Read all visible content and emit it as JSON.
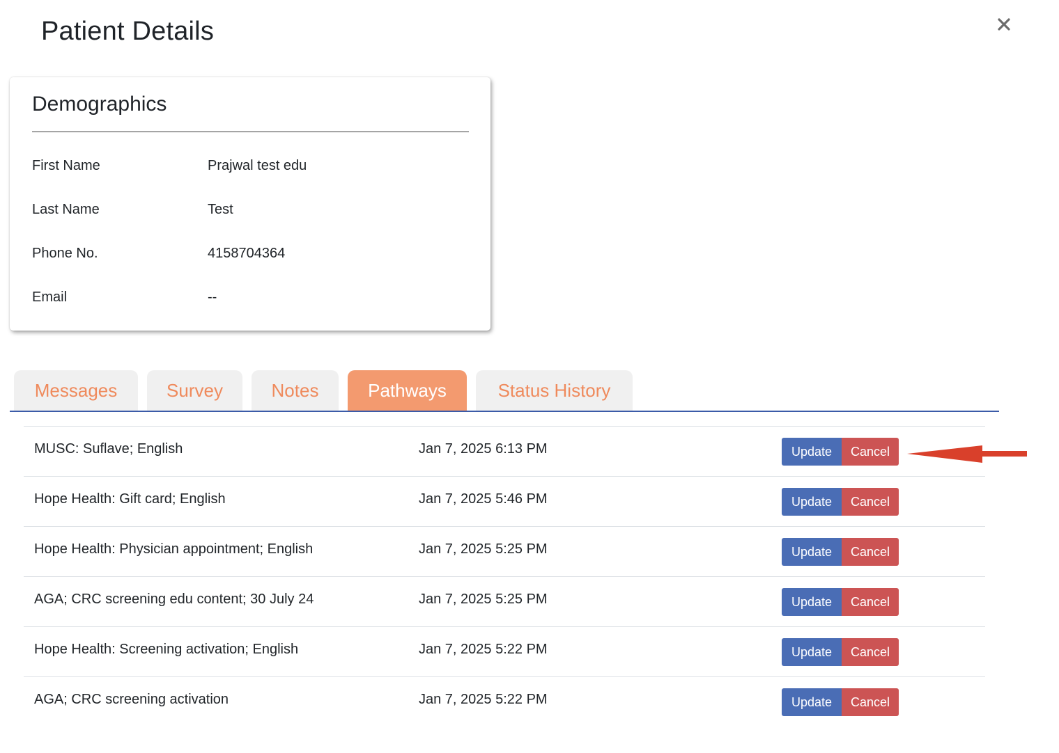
{
  "header": {
    "title": "Patient Details",
    "close_icon": "close-icon"
  },
  "demographics": {
    "title": "Demographics",
    "fields": [
      {
        "label": "First Name",
        "value": "Prajwal test edu"
      },
      {
        "label": "Last Name",
        "value": "Test"
      },
      {
        "label": "Phone No.",
        "value": "4158704364"
      },
      {
        "label": "Email",
        "value": "--"
      }
    ]
  },
  "tabs": [
    {
      "label": "Messages",
      "active": false
    },
    {
      "label": "Survey",
      "active": false
    },
    {
      "label": "Notes",
      "active": false
    },
    {
      "label": "Pathways",
      "active": true
    },
    {
      "label": "Status History",
      "active": false
    }
  ],
  "pathways": {
    "update_label": "Update",
    "cancel_label": "Cancel",
    "rows": [
      {
        "name": "MUSC: Suflave; English",
        "date": "Jan 7, 2025 6:13 PM"
      },
      {
        "name": "Hope Health: Gift card; English",
        "date": "Jan 7, 2025 5:46 PM"
      },
      {
        "name": "Hope Health: Physician appointment; English",
        "date": "Jan 7, 2025 5:25 PM"
      },
      {
        "name": "AGA; CRC screening edu content; 30 July 24",
        "date": "Jan 7, 2025 5:25 PM"
      },
      {
        "name": "Hope Health: Screening activation; English",
        "date": "Jan 7, 2025 5:22 PM"
      },
      {
        "name": "AGA; CRC screening activation",
        "date": "Jan 7, 2025 5:22 PM"
      }
    ]
  },
  "colors": {
    "tab_text": "#ef8a5c",
    "tab_active_bg": "#f39a6f",
    "tab_inactive_bg": "#f0f0f0",
    "tab_underline": "#3b5ba8",
    "update_button": "#4a6db5",
    "cancel_button": "#cc5454",
    "annotation_arrow": "#d9402b"
  }
}
